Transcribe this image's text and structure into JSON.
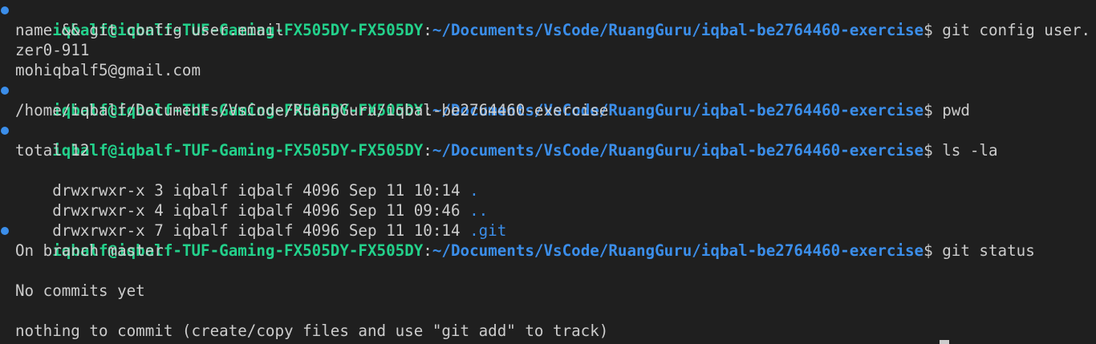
{
  "theme": {
    "background": "#1f1f1f",
    "foreground": "#cccccc",
    "prompt_user_color": "#23d18b",
    "prompt_path_color": "#3b8eea",
    "directory_color": "#3b8eea",
    "decoration_success_color": "#3b8eea"
  },
  "prompt": {
    "user_host": "iqbalf@iqbalf-TUF-Gaming-FX505DY-FX505DY",
    "separator": ":",
    "path": "~/Documents/VsCode/RuangGuru/iqbal-be2764460-exercise",
    "symbol": "$"
  },
  "blocks": [
    {
      "command": " git config user.",
      "command_wrap": "name && git config user.email",
      "output": [
        "zer0-911",
        "mohiqbalf5@gmail.com"
      ]
    },
    {
      "command": " pwd",
      "output": [
        "/home/iqbalf/Documents/VsCode/RuangGuru/iqbal-be2764460-exercise"
      ]
    },
    {
      "command": " ls -la",
      "output": [
        "total 12"
      ],
      "listing": [
        {
          "meta": "drwxrwxr-x 3 iqbalf iqbalf 4096 Sep 11 10:14 ",
          "name": "."
        },
        {
          "meta": "drwxrwxr-x 4 iqbalf iqbalf 4096 Sep 11 09:46 ",
          "name": ".."
        },
        {
          "meta": "drwxrwxr-x 7 iqbalf iqbalf 4096 Sep 11 10:14 ",
          "name": ".git"
        }
      ]
    },
    {
      "command": " git status",
      "output": [
        "On branch master",
        "",
        "No commits yet",
        "",
        "nothing to commit (create/copy files and use \"git add\" to track)"
      ]
    }
  ]
}
